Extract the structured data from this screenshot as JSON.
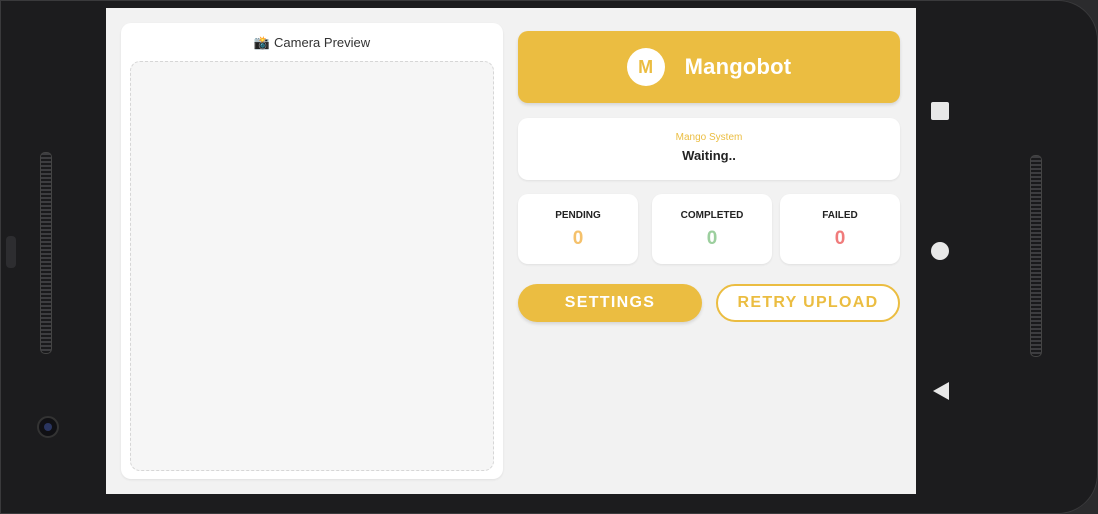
{
  "camera": {
    "title": "Camera Preview",
    "icon": "camera-icon"
  },
  "brand": {
    "logo_letter": "M",
    "name": "Mangobot",
    "color": "#ebbd41"
  },
  "status": {
    "label": "Mango System",
    "value": "Waiting.."
  },
  "stats": {
    "pending": {
      "label": "PENDING",
      "value": "0",
      "color": "#f5c16b"
    },
    "completed": {
      "label": "COMPLETED",
      "value": "0",
      "color": "#9ccf9e"
    },
    "failed": {
      "label": "FAILED",
      "value": "0",
      "color": "#f07b7b"
    }
  },
  "actions": {
    "settings_label": "SETTINGS",
    "retry_label": "RETRY UPLOAD"
  },
  "navigation": {
    "recents_icon": "square-recents-icon",
    "home_icon": "circle-home-icon",
    "back_icon": "triangle-back-icon"
  }
}
